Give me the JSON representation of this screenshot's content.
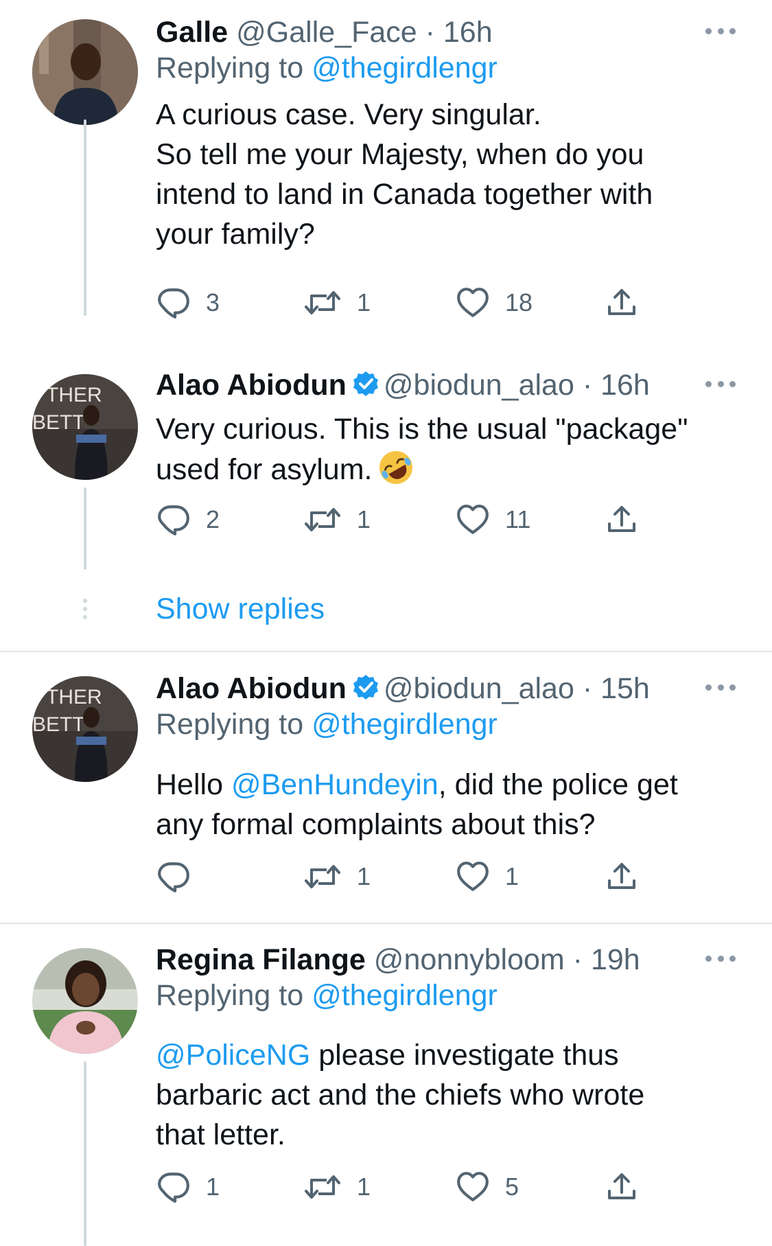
{
  "colors": {
    "accent": "#1d9bf0",
    "text": "#0f1419",
    "muted": "#536471",
    "thread_line": "#cfd9de"
  },
  "tweets": [
    {
      "name": "Galle",
      "handle": "@Galle_Face",
      "separator": "·",
      "time": "16h",
      "verified": false,
      "replying_prefix": "Replying to",
      "replying_to": "@thegirdlengr",
      "text_lines": [
        "A curious case. Very singular.",
        "So tell me your Majesty, when do you",
        "intend to land in Canada together with",
        "your family?"
      ],
      "replies": "3",
      "retweets": "1",
      "likes": "18"
    },
    {
      "name": "Alao Abiodun",
      "handle": "@biodun_alao",
      "separator": "·",
      "time": "16h",
      "verified": true,
      "avatar_text": [
        "THER",
        "BETT"
      ],
      "text_lines": [
        "Very curious. This is the usual \"package\"",
        "used for asylum."
      ],
      "emoji": "rolling-on-floor-laughing",
      "replies": "2",
      "retweets": "1",
      "likes": "11"
    },
    {
      "name": "Alao Abiodun",
      "handle": "@biodun_alao",
      "separator": "·",
      "time": "15h",
      "verified": true,
      "avatar_text": [
        "THER",
        "BETT"
      ],
      "replying_prefix": "Replying to",
      "replying_to": "@thegirdlengr",
      "text_prefix": "Hello ",
      "text_mention": "@BenHundeyin",
      "text_rest_line1": ", did the police get",
      "text_line2": "any formal complaints about this?",
      "replies": "",
      "retweets": "1",
      "likes": "1"
    },
    {
      "name": "Regina Filange",
      "handle": "@nonnybloom",
      "separator": "·",
      "time": "19h",
      "verified": false,
      "replying_prefix": "Replying to",
      "replying_to": "@thegirdlengr",
      "text_mention": "@PoliceNG",
      "text_rest_line1": " please investigate thus",
      "text_line2": "barbaric act and the chiefs who wrote",
      "text_line3": "that letter.",
      "replies": "1",
      "retweets": "1",
      "likes": "5"
    }
  ],
  "show_replies": "Show replies",
  "icons": {
    "reply": "reply-icon",
    "retweet": "retweet-icon",
    "like": "heart-icon",
    "share": "share-icon",
    "more": "more-icon",
    "verified": "verified-badge-icon"
  }
}
